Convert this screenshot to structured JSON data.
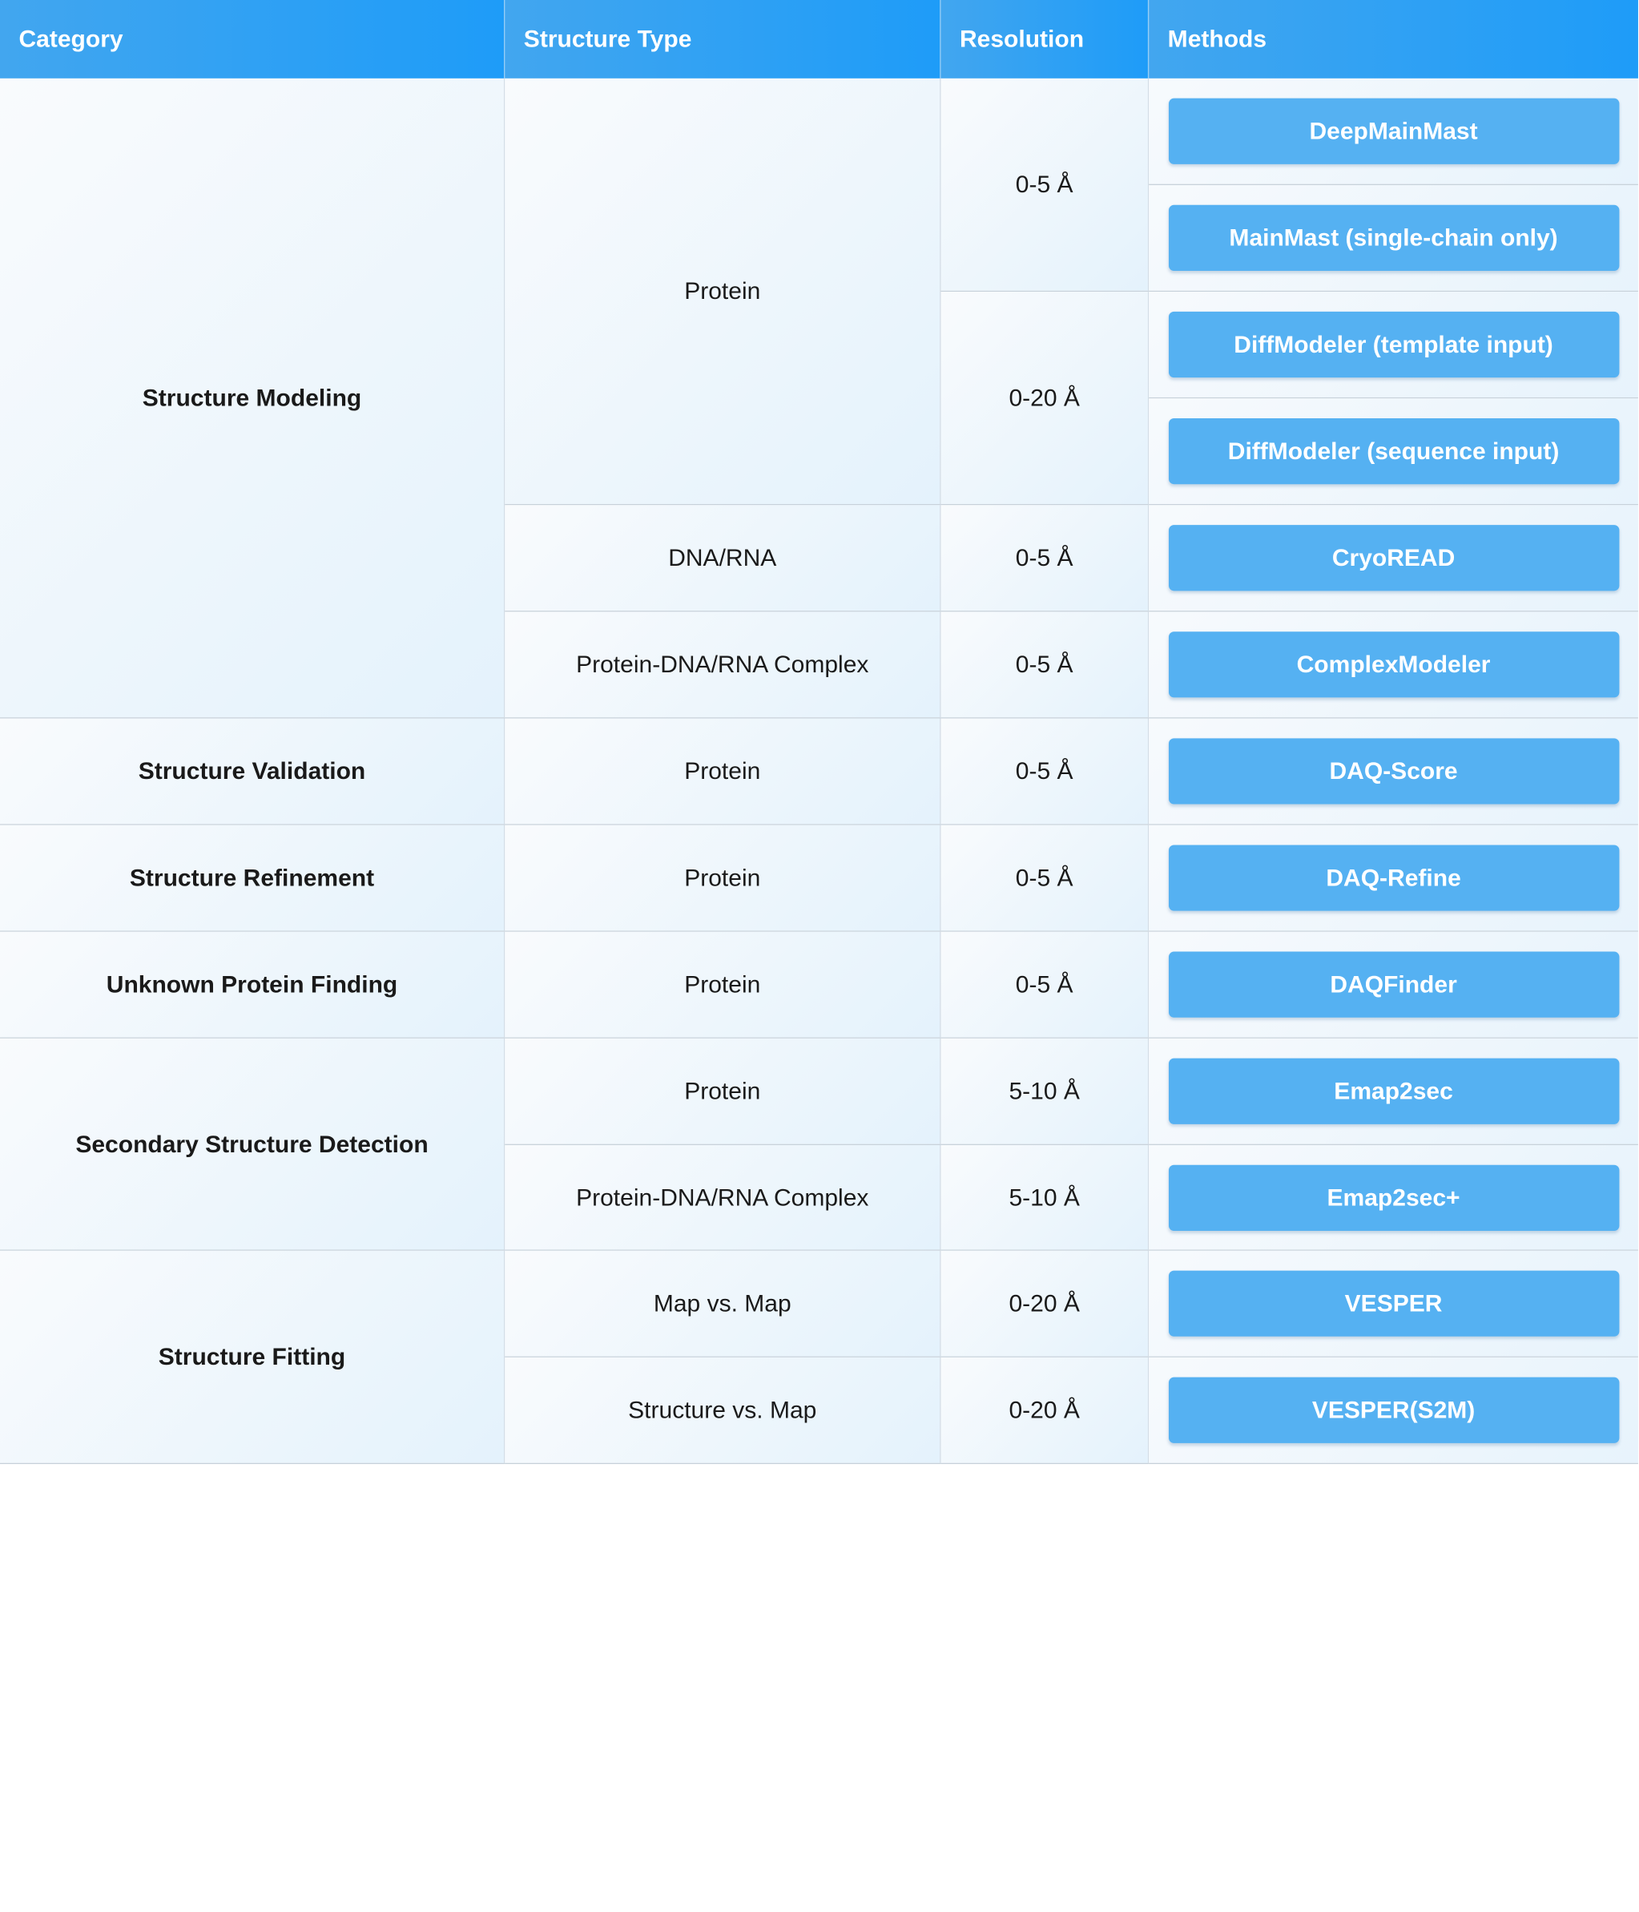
{
  "headers": [
    "Category",
    "Structure Type",
    "Resolution",
    "Methods"
  ],
  "categories": [
    "Structure Modeling",
    "Structure Validation",
    "Structure Refinement",
    "Unknown Protein Finding",
    "Secondary Structure Detection",
    "Structure Fitting"
  ],
  "structure_types": [
    "Protein",
    "DNA/RNA",
    "Protein-DNA/RNA Complex",
    "Protein",
    "Protein",
    "Protein",
    "Protein",
    "Protein-DNA/RNA Complex",
    "Map vs. Map",
    "Structure vs. Map"
  ],
  "resolutions": [
    "0-5 Å",
    "0-20 Å",
    "0-5 Å",
    "0-5 Å",
    "0-5 Å",
    "0-5 Å",
    "0-5 Å",
    "5-10 Å",
    "5-10 Å",
    "0-20 Å",
    "0-20 Å"
  ],
  "methods": [
    "DeepMainMast",
    "MainMast (single-chain only)",
    "DiffModeler (template input)",
    "DiffModeler (sequence input)",
    "CryoREAD",
    "ComplexModeler",
    "DAQ-Score",
    "DAQ-Refine",
    "DAQFinder",
    "Emap2sec",
    "Emap2sec+",
    "VESPER",
    "VESPER(S2M)"
  ]
}
